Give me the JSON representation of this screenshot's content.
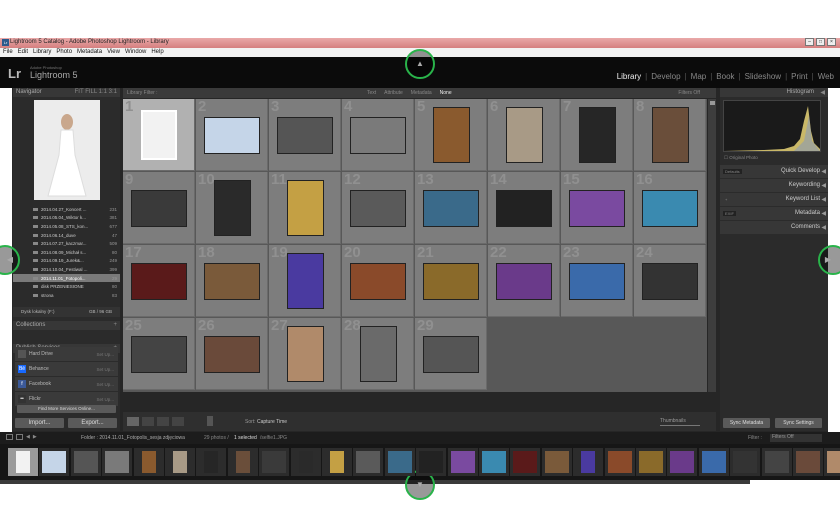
{
  "window": {
    "title": "Lightroom 5 Catalog - Adobe Photoshop Lightroom - Library",
    "app_badge": "Lr",
    "controls": [
      "–",
      "□",
      "×"
    ]
  },
  "menu": [
    "File",
    "Edit",
    "Library",
    "Photo",
    "Metadata",
    "View",
    "Window",
    "Help"
  ],
  "brand": {
    "logo": "Lr",
    "sub1": "Adobe Photoshop",
    "sub2": "Lightroom 5"
  },
  "modules": [
    {
      "label": "Library",
      "active": true
    },
    {
      "label": "Develop"
    },
    {
      "label": "Map"
    },
    {
      "label": "Book"
    },
    {
      "label": "Slideshow"
    },
    {
      "label": "Print"
    },
    {
      "label": "Web"
    }
  ],
  "navigator": {
    "title": "Navigator",
    "zoom": "FIT  FILL  1:1  3:1"
  },
  "folders": [
    {
      "name": "2014.04.27_Koncert ...",
      "count": "231"
    },
    {
      "name": "2014.05.04_Wiktor k...",
      "count": "381"
    },
    {
      "name": "2014.05.08_STS_kon...",
      "count": "677"
    },
    {
      "name": "2014.06.14_duve",
      "count": "47"
    },
    {
      "name": "2014.07.27_kaczmar...",
      "count": "509"
    },
    {
      "name": "2014.08.09_Michał s...",
      "count": "80"
    },
    {
      "name": "2014.09.19_Jurek&...",
      "count": "249"
    },
    {
      "name": "2014.10.04_Festiwal ...",
      "count": "399"
    },
    {
      "name": "2014.11.01_Fotopoli...",
      "count": "29",
      "selected": true
    },
    {
      "name": "disk PRZENIESIONE",
      "count": "80"
    },
    {
      "name": "strona",
      "count": "83"
    }
  ],
  "drive": {
    "name": "Dysk lokalny (F:)",
    "space": "GB / 96 GB"
  },
  "collections": "Collections",
  "publish": {
    "title": "Publish Services",
    "services": [
      {
        "name": "Hard Drive",
        "action": "Set Up..."
      },
      {
        "name": "Behance",
        "logo": "Bē",
        "color": "#1769ff",
        "action": "Set Up..."
      },
      {
        "name": "Facebook",
        "logo": "f",
        "color": "#3b5998",
        "action": "Set Up..."
      },
      {
        "name": "Flickr",
        "logo": "••",
        "color": "#333",
        "action": "Set Up..."
      }
    ],
    "more": "Find More Services Online..."
  },
  "left_buttons": {
    "import": "Import...",
    "export": "Export..."
  },
  "filter_bar": {
    "label": "Library Filter :",
    "tabs": [
      "Text",
      "Attribute",
      "Metadata",
      "None"
    ],
    "active": "None",
    "right": "Filters Off"
  },
  "grid": {
    "cells": [
      {
        "n": "1",
        "c": "#f2f2f2",
        "w": 36,
        "h": 50,
        "sel": true
      },
      {
        "n": "2",
        "c": "#c5d5e8",
        "w": 56,
        "h": 37
      },
      {
        "n": "3",
        "c": "#555",
        "w": 56,
        "h": 37
      },
      {
        "n": "4",
        "c": "#7a7a7a",
        "w": 56,
        "h": 37
      },
      {
        "n": "5",
        "c": "#8a5a2e",
        "w": 37,
        "h": 56
      },
      {
        "n": "6",
        "c": "#a89a86",
        "w": 37,
        "h": 56
      },
      {
        "n": "7",
        "c": "#262626",
        "w": 37,
        "h": 56
      },
      {
        "n": "8",
        "c": "#6a4e3a",
        "w": 37,
        "h": 56
      },
      {
        "n": "9",
        "c": "#3a3a3a",
        "w": 56,
        "h": 37
      },
      {
        "n": "10",
        "c": "#2a2a2a",
        "w": 37,
        "h": 56
      },
      {
        "n": "11",
        "c": "#c4a044",
        "w": 37,
        "h": 56
      },
      {
        "n": "12",
        "c": "#5a5a5a",
        "w": 56,
        "h": 37
      },
      {
        "n": "13",
        "c": "#3a6a8a",
        "w": 56,
        "h": 37
      },
      {
        "n": "14",
        "c": "#222",
        "w": 56,
        "h": 37
      },
      {
        "n": "15",
        "c": "#7a4aa0",
        "w": 56,
        "h": 37
      },
      {
        "n": "16",
        "c": "#3a8ab0",
        "w": 56,
        "h": 37
      },
      {
        "n": "17",
        "c": "#5a1a1a",
        "w": 56,
        "h": 37
      },
      {
        "n": "18",
        "c": "#7a5a3a",
        "w": 56,
        "h": 37
      },
      {
        "n": "19",
        "c": "#4a3aa0",
        "w": 37,
        "h": 56
      },
      {
        "n": "20",
        "c": "#8a4a2a",
        "w": 56,
        "h": 37
      },
      {
        "n": "21",
        "c": "#8a6a2a",
        "w": 56,
        "h": 37
      },
      {
        "n": "22",
        "c": "#6a3a8a",
        "w": 56,
        "h": 37
      },
      {
        "n": "23",
        "c": "#3a6aaa",
        "w": 56,
        "h": 37
      },
      {
        "n": "24",
        "c": "#333",
        "w": 56,
        "h": 37
      },
      {
        "n": "25",
        "c": "#444",
        "w": 56,
        "h": 37
      },
      {
        "n": "26",
        "c": "#6a4a3a",
        "w": 56,
        "h": 37
      },
      {
        "n": "27",
        "c": "#b08a6a",
        "w": 37,
        "h": 56
      },
      {
        "n": "28",
        "c": "#6a6a6a",
        "w": 37,
        "h": 56
      },
      {
        "n": "29",
        "c": "#555",
        "w": 56,
        "h": 37
      }
    ]
  },
  "toolbar": {
    "sort_label": "Sort:",
    "sort_value": "Capture Time",
    "thumbs": "Thumbnails"
  },
  "right": {
    "histogram": "Histogram",
    "original_photo": "Original Photo",
    "quick_develop": "Quick Develop",
    "qd_preset": "Defaults",
    "keywording": "Keywording",
    "keyword_list": "Keyword List",
    "metadata": "Metadata",
    "meta_preset": "EXIF",
    "comments": "Comments",
    "sync_metadata": "Sync Metadata",
    "sync_settings": "Sync Settings"
  },
  "filmstrip_bar": {
    "text": "Folder : 2014.11.01_Fotopolis_sesja zdjęciowa",
    "count": "29 photos /",
    "selected": "1 selected",
    "file": "/selfie1.JPG",
    "filter_label": "Filter :",
    "filter_value": "Filters Off"
  },
  "filmstrip": [
    "#f2f2f2",
    "#c5d5e8",
    "#555",
    "#7a7a7a",
    "#8a5a2e",
    "#a89a86",
    "#262626",
    "#6a4e3a",
    "#3a3a3a",
    "#2a2a2a",
    "#c4a044",
    "#5a5a5a",
    "#3a6a8a",
    "#222",
    "#7a4aa0",
    "#3a8ab0",
    "#5a1a1a",
    "#7a5a3a",
    "#4a3aa0",
    "#8a4a2a",
    "#8a6a2a",
    "#6a3a8a",
    "#3a6aaa",
    "#333",
    "#444",
    "#6a4a3a",
    "#b08a6a"
  ],
  "edge_arrows": {
    "top": "▲",
    "bottom": "▼",
    "left": "◀",
    "right": "▶"
  }
}
